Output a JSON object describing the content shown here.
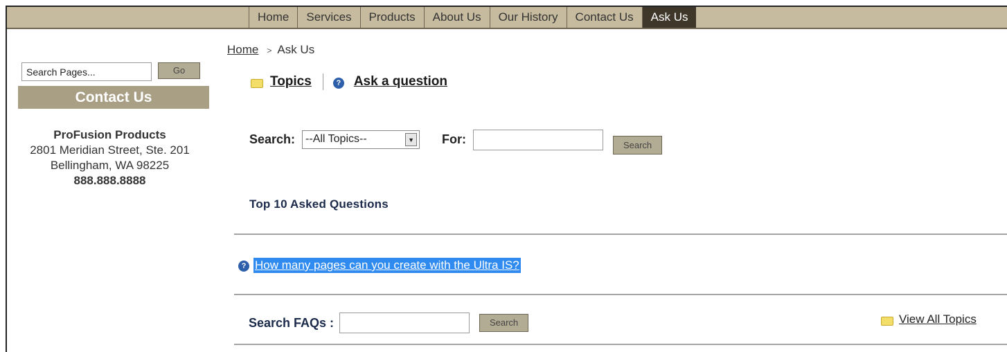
{
  "nav": {
    "items": [
      {
        "label": "Home",
        "active": false
      },
      {
        "label": "Services",
        "active": false
      },
      {
        "label": "Products",
        "active": false
      },
      {
        "label": "About Us",
        "active": false
      },
      {
        "label": "Our History",
        "active": false
      },
      {
        "label": "Contact Us",
        "active": false
      },
      {
        "label": "Ask Us",
        "active": true
      }
    ]
  },
  "sidebar": {
    "search_value": "Search Pages...",
    "go_label": "Go",
    "contact_header": "Contact Us",
    "company": "ProFusion Products",
    "street": "2801 Meridian Street, Ste. 201",
    "city": "Bellingham, WA 98225",
    "phone": "888.888.8888"
  },
  "breadcrumb": {
    "home": "Home",
    "separator": ">",
    "current": "Ask Us"
  },
  "tools": {
    "topics": "Topics",
    "ask": "Ask a question"
  },
  "search": {
    "label": "Search:",
    "select_value": "--All Topics--",
    "for_label": "For:",
    "for_value": "",
    "button": "Search"
  },
  "top10": {
    "heading": "Top 10 Asked Questions",
    "questions": [
      "How many pages can you create with the Ultra IS?"
    ]
  },
  "faq_search": {
    "label": "Search FAQs :",
    "value": "",
    "button": "Search",
    "view_all": "View All Topics"
  },
  "colors": {
    "nav_bg": "#c6bb9f",
    "nav_active": "#3e372a",
    "sidebar_header": "#a89f85",
    "button_bg": "#b3ac94",
    "selection": "#2f8bf0"
  },
  "icons": {
    "folder": "folder-icon",
    "help": "help-icon",
    "dropdown": "chevron-down-icon"
  }
}
